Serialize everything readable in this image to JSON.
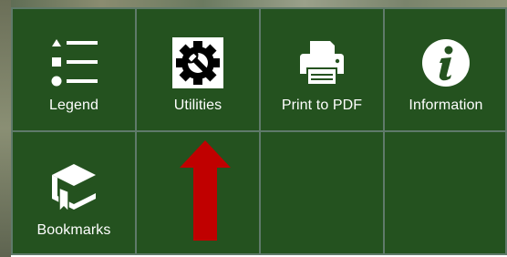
{
  "panel": {
    "background_color": "#24521f",
    "border_color": "#5f7a6a",
    "tiles": [
      {
        "label": "Legend",
        "icon": "list-icon"
      },
      {
        "label": "Utilities",
        "icon": "gear-wrench-icon"
      },
      {
        "label": "Print to PDF",
        "icon": "printer-icon"
      },
      {
        "label": "Information",
        "icon": "info-icon"
      },
      {
        "label": "Bookmarks",
        "icon": "bookmark-book-icon"
      }
    ]
  },
  "annotation": {
    "arrow_color": "#c00000",
    "points_to": "Utilities"
  }
}
